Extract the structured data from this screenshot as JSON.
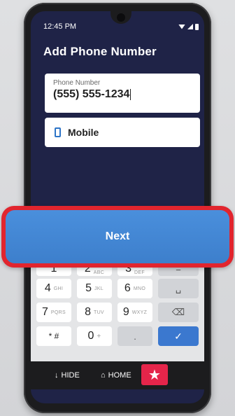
{
  "status_bar": {
    "time": "12:45 PM"
  },
  "screen": {
    "title": "Add Phone Number"
  },
  "phone_field": {
    "label": "Phone Number",
    "value": "(555) 555-1234"
  },
  "phone_type": {
    "icon": "mobile-phone-icon",
    "label": "Mobile"
  },
  "next_button": {
    "label": "Next",
    "accent_color": "#3d7fcc",
    "highlight_color": "#e1252e"
  },
  "keypad": {
    "row1": [
      {
        "num": "1",
        "sub": ""
      },
      {
        "num": "2",
        "sub": "ABC"
      },
      {
        "num": "3",
        "sub": "DEF"
      },
      {
        "num": "−",
        "sub": ""
      }
    ],
    "row2": [
      {
        "num": "4",
        "sub": "GHI"
      },
      {
        "num": "5",
        "sub": "JKL"
      },
      {
        "num": "6",
        "sub": "MNO"
      },
      {
        "num": "␣",
        "sub": ""
      }
    ],
    "row3": [
      {
        "num": "7",
        "sub": "PQRS"
      },
      {
        "num": "8",
        "sub": "TUV"
      },
      {
        "num": "9",
        "sub": "WXYZ"
      },
      {
        "num": "⌫",
        "sub": ""
      }
    ],
    "row4": [
      {
        "num": "* #",
        "sub": ""
      },
      {
        "num": "0",
        "sub": "+"
      },
      {
        "num": ".",
        "sub": ""
      },
      {
        "num": "✓",
        "sub": ""
      }
    ]
  },
  "nav_bar": {
    "hide_label": "HIDE",
    "home_label": "HOME",
    "star_icon": "star-icon",
    "star_color": "#e5254a"
  }
}
